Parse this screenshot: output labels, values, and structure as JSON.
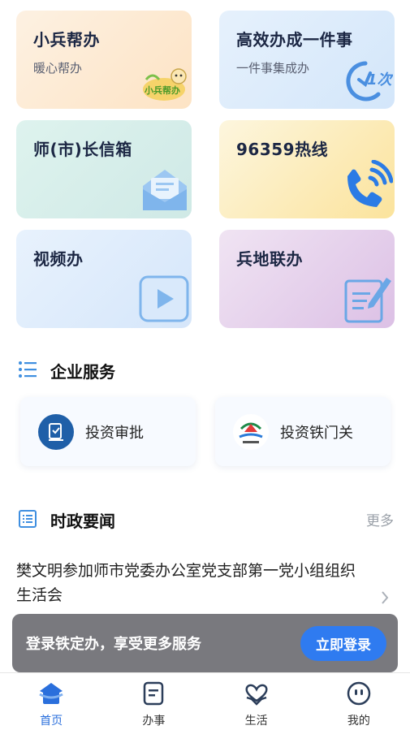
{
  "cards": [
    {
      "title": "小兵帮办",
      "sub": "暖心帮办",
      "icon": "mascot-icon",
      "badge": "小兵帮办"
    },
    {
      "title": "高效办成一件事",
      "sub": "一件事集成办",
      "icon": "once-clock-icon",
      "badge": "1次"
    },
    {
      "title": "师(市)长信箱",
      "sub": "",
      "icon": "mail-icon"
    },
    {
      "title": "96359热线",
      "sub": "",
      "icon": "phone-icon"
    },
    {
      "title": "视频办",
      "sub": "",
      "icon": "video-play-icon"
    },
    {
      "title": "兵地联办",
      "sub": "",
      "icon": "document-edit-icon"
    }
  ],
  "enterprise": {
    "heading": "企业服务",
    "items": [
      {
        "name": "投资审批",
        "icon": "investment-approval-logo"
      },
      {
        "name": "投资铁门关",
        "icon": "invest-tiemenguan-logo"
      }
    ]
  },
  "news": {
    "heading": "时政要闻",
    "more": "更多",
    "headline": "樊文明参加师市党委办公室党支部第一党小组组织生活会"
  },
  "login": {
    "message": "登录铁定办，享受更多服务",
    "button": "立即登录"
  },
  "tabs": [
    {
      "label": "首页",
      "icon": "home-icon",
      "active": true
    },
    {
      "label": "办事",
      "icon": "task-icon",
      "active": false
    },
    {
      "label": "生活",
      "icon": "life-heart-icon",
      "active": false
    },
    {
      "label": "我的",
      "icon": "profile-icon",
      "active": false
    }
  ],
  "colors": {
    "accent": "#2f7bf0",
    "tab_active": "#2a6fdc",
    "icon_blue": "#3f8fe0"
  }
}
